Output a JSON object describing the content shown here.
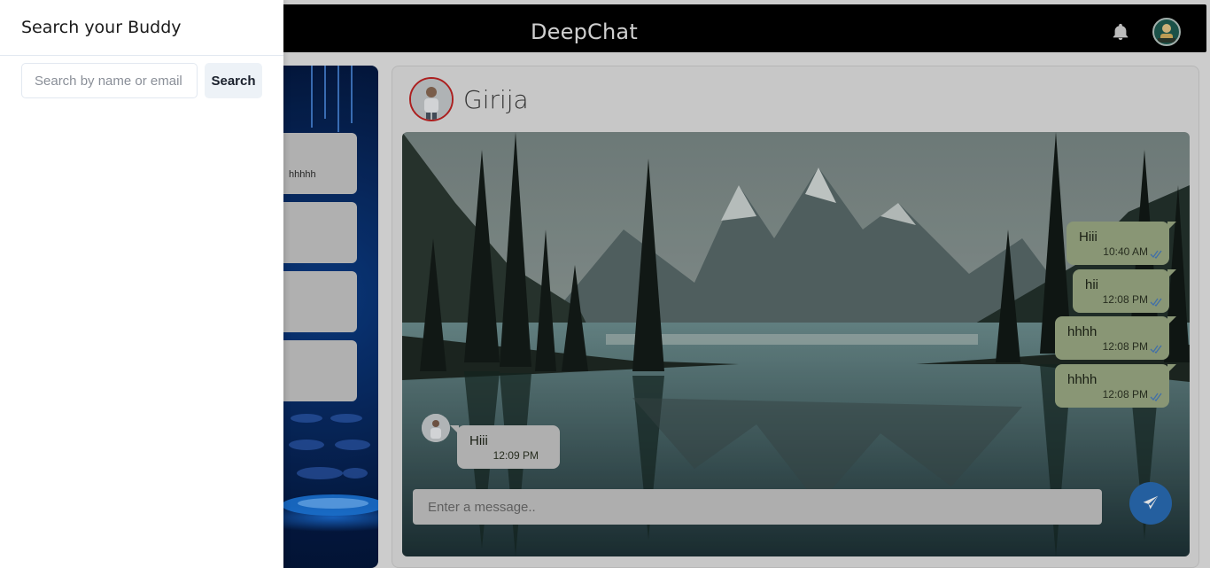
{
  "header": {
    "brand": "DeepChat",
    "notification_icon": "bell-icon",
    "profile_icon": "avatar"
  },
  "chat_list": {
    "preview_snippet": "hhhhh"
  },
  "conversation": {
    "contact_name": "Girija",
    "messages": [
      {
        "direction": "sent",
        "text": "Hiii",
        "time": "10:40 AM",
        "status_icon": "double-check-icon"
      },
      {
        "direction": "sent",
        "text": "hii",
        "time": "12:08 PM",
        "status_icon": "double-check-icon"
      },
      {
        "direction": "sent",
        "text": "hhhh",
        "time": "12:08 PM",
        "status_icon": "double-check-icon"
      },
      {
        "direction": "sent",
        "text": "hhhh",
        "time": "12:08 PM",
        "status_icon": "double-check-icon"
      },
      {
        "direction": "received",
        "text": "Hiii",
        "time": "12:09 PM"
      }
    ],
    "input_placeholder": "Enter a message..",
    "send_icon": "paper-plane-icon"
  },
  "drawer": {
    "title": "Search your Buddy",
    "search_placeholder": "Search by name or email",
    "search_button": "Search"
  },
  "colors": {
    "topbar": "#000000",
    "sent_bubble": "#9cab86",
    "received_bubble": "#c8c8c8",
    "send_button": "#2a6db6",
    "contact_avatar_ring": "#c42424"
  }
}
